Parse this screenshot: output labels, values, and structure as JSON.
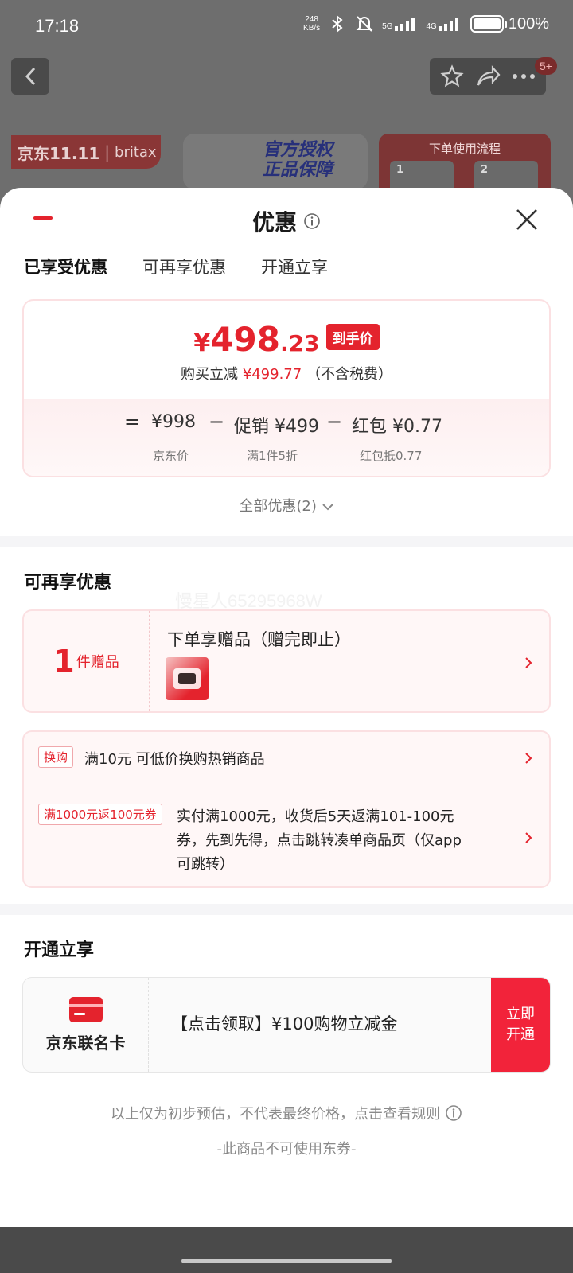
{
  "status_bar": {
    "time": "17:18",
    "net_speed_value": "248",
    "net_speed_unit": "KB/s",
    "sig1_label": "5G",
    "sig2_label": "4G",
    "battery_level": 1.0,
    "battery_text": "100%"
  },
  "background": {
    "badge_count": "5+",
    "banner_left_brand": "京东11.11",
    "banner_left_brand2": "britax",
    "banner_mid_line1": "官方授权",
    "banner_mid_line2": "正品保障",
    "banner_right_title": "下单使用流程",
    "step1": "1",
    "step2": "2"
  },
  "sheet": {
    "title": "优惠",
    "tabs": [
      {
        "label": "已享受优惠",
        "active": true
      },
      {
        "label": "可再享优惠",
        "active": false
      },
      {
        "label": "开通立享",
        "active": false
      }
    ],
    "price": {
      "yen": "¥",
      "integer": "498",
      "decimal": ".23",
      "tag": "到手价",
      "save_prefix": "购买立减",
      "save_amount": "¥499.77",
      "save_suffix": "（不含税费）"
    },
    "calc": {
      "eq": "=",
      "items": [
        {
          "value": "¥998",
          "sub": "京东价"
        },
        {
          "value": "促销 ¥499",
          "sub": "满1件5折"
        },
        {
          "value": "红包 ¥0.77",
          "sub": "红包抵0.77"
        }
      ],
      "minus": "−"
    },
    "all_discounts": "全部优惠(2)",
    "section_more": "可再享优惠",
    "watermark": "慢星人65295968W",
    "gift": {
      "count": "1",
      "unit": "件赠品",
      "title": "下单享赠品（赠完即止）"
    },
    "promos": [
      {
        "tag": "换购",
        "text": "满10元 可低价换购热销商品"
      },
      {
        "tag": "满1000元返100元券",
        "text_lines": [
          "实付满1000元，收货后5天返满101-100元",
          "券，先到先得，点击跳转凑单商品页（仅app",
          "可跳转）"
        ]
      }
    ],
    "section_open": "开通立享",
    "jd_card": {
      "name": "京东联名卡",
      "text": "【点击领取】¥100购物立减金",
      "button": "立即开通"
    },
    "footer_note": "以上仅为初步预估，不代表最终价格，点击查看规则",
    "footer_note2": "-此商品不可使用东券-"
  },
  "colors": {
    "accent": "#e4232d",
    "button_red": "#f2233a"
  },
  "icons": [
    "back-arrow-icon",
    "star-icon",
    "share-icon",
    "more-icon",
    "bluetooth-icon",
    "mute-icon",
    "info-icon",
    "close-icon",
    "chevron-down-icon",
    "chevron-right-icon",
    "credit-card-icon"
  ]
}
